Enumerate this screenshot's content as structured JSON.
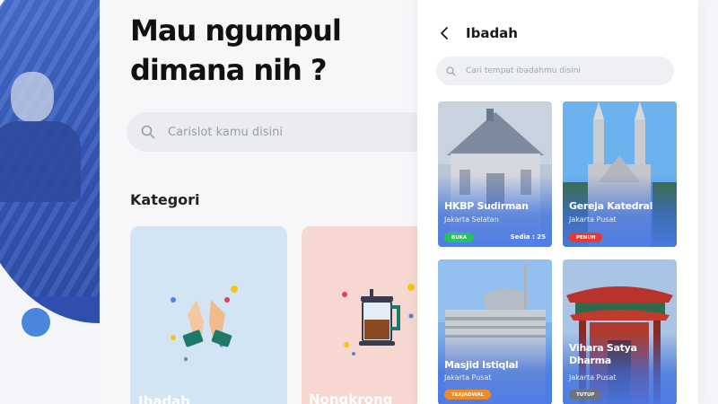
{
  "home": {
    "headline_line1": "Mau ngumpul",
    "headline_line2": "dimana nih ?",
    "search_placeholder": "Carislot kamu disini",
    "section_title": "Kategori",
    "categories": [
      {
        "label": "Ibadah",
        "icon": "praying-hands-icon",
        "color": "#d3e4f5"
      },
      {
        "label": "Nongkrong",
        "icon": "coffee-press-icon",
        "color": "#f6d8d0"
      }
    ]
  },
  "ibadah_screen": {
    "title": "Ibadah",
    "search_placeholder": "Cari tempat ibadahmu disini",
    "places": [
      {
        "name": "HKBP Sudirman",
        "location": "Jakarta Selatan",
        "status": "BUKA",
        "status_color": "#22c55e",
        "slots": "Sedia : 25"
      },
      {
        "name": "Gereja Katedral",
        "location": "Jakarta Pusat",
        "status": "PENUH",
        "status_color": "#e53935",
        "slots": ""
      },
      {
        "name": "Masjid Istiqlal",
        "location": "Jakarta Pusat",
        "status": "TERJADWAL",
        "status_color": "#f08a24",
        "slots": ""
      },
      {
        "name": "Vihara Satya Dharma",
        "location": "Jakarta Pusat",
        "status": "TUTUP",
        "status_color": "#6b7280",
        "slots": ""
      }
    ]
  },
  "colors": {
    "accent": "#4a85de",
    "card_overlay": "#4a78e6"
  }
}
